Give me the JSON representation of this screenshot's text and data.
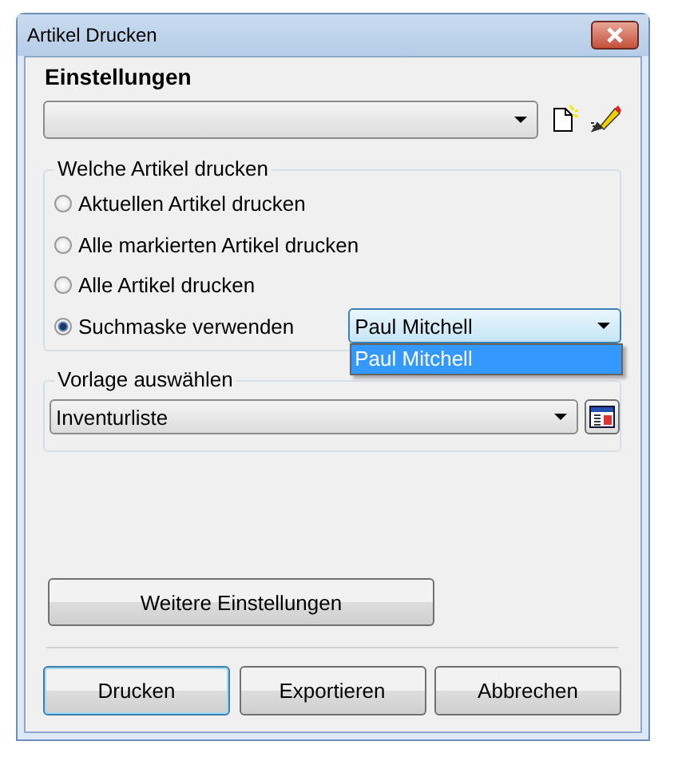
{
  "window": {
    "title": "Artikel Drucken"
  },
  "settings": {
    "heading": "Einstellungen"
  },
  "print_group": {
    "title": "Welche Artikel drucken",
    "options": [
      {
        "label": "Aktuellen Artikel drucken",
        "selected": false
      },
      {
        "label": "Alle markierten Artikel drucken",
        "selected": false
      },
      {
        "label": "Alle Artikel drucken",
        "selected": false
      },
      {
        "label": "Suchmaske verwenden",
        "selected": true
      }
    ],
    "search_mask": {
      "value": "Paul Mitchell",
      "expanded": true,
      "options": [
        {
          "label": "Paul Mitchell",
          "selected": true
        }
      ]
    }
  },
  "template_group": {
    "title": "Vorlage auswählen",
    "value": "Inventurliste"
  },
  "more_button": "Weitere Einstellungen",
  "buttons": [
    {
      "label": "Drucken",
      "default": true
    },
    {
      "label": "Exportieren",
      "default": false
    },
    {
      "label": "Abbrechen",
      "default": false
    }
  ]
}
